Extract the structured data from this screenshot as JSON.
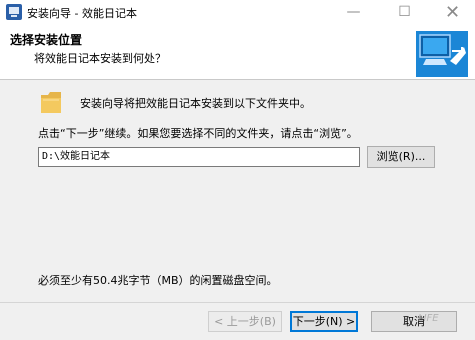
{
  "window": {
    "title": "安装向导 - 效能日记本",
    "minimize": "—",
    "maximize": "☐",
    "close": "✕"
  },
  "header": {
    "title": "选择安装位置",
    "subtitle": "将效能日记本安装到何处？"
  },
  "main": {
    "intro": "安装向导将把效能日记本安装到以下文件夹中。",
    "instruction": "点击“下一步”继续。如果您要选择不同的文件夹，请点击“浏览”。",
    "install_path": "D:\\效能日记本",
    "browse_label": "浏览(R)...",
    "space_required": "必须至少有50.4兆字节（MB）的闲置磁盘空间。"
  },
  "footer": {
    "back_label": "< 上一步(B)",
    "next_label": "下一步(N) >",
    "cancel_label": "取消"
  },
  "watermark": "LIFE"
}
